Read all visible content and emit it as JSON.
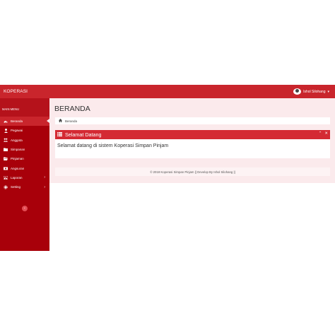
{
  "navbar": {
    "brand": "KOPERASI",
    "user_name": "Ishol Silohang"
  },
  "sidebar": {
    "header": "MAIN MENU",
    "items": [
      {
        "label": "Beranda",
        "icon": "dashboard-icon",
        "active": true
      },
      {
        "label": "Pegawai",
        "icon": "user-icon"
      },
      {
        "label": "Anggota",
        "icon": "users-icon"
      },
      {
        "label": "Simpanan",
        "icon": "folder-icon"
      },
      {
        "label": "Pinjaman",
        "icon": "folder-open-icon"
      },
      {
        "label": "Angsuran",
        "icon": "money-icon"
      },
      {
        "label": "Laporan",
        "icon": "bar-chart-icon",
        "has_submenu": true
      },
      {
        "label": "Setting",
        "icon": "gear-icon",
        "has_submenu": true
      }
    ]
  },
  "main": {
    "page_title": "BERANDA",
    "breadcrumb": "Beranda",
    "box": {
      "title": "Selamat Datang",
      "body": "Selamat datang di sistem Koperasi Simpan Pinjam"
    },
    "footer": "© 2018 Koperasi Simpan Pinjam || Develop By Ishol Silohang ||"
  },
  "colors": {
    "navbar": "#c9252c",
    "sidebar": "#a8000a",
    "content_bg": "#fbeaec",
    "box_header": "#d42a33"
  }
}
